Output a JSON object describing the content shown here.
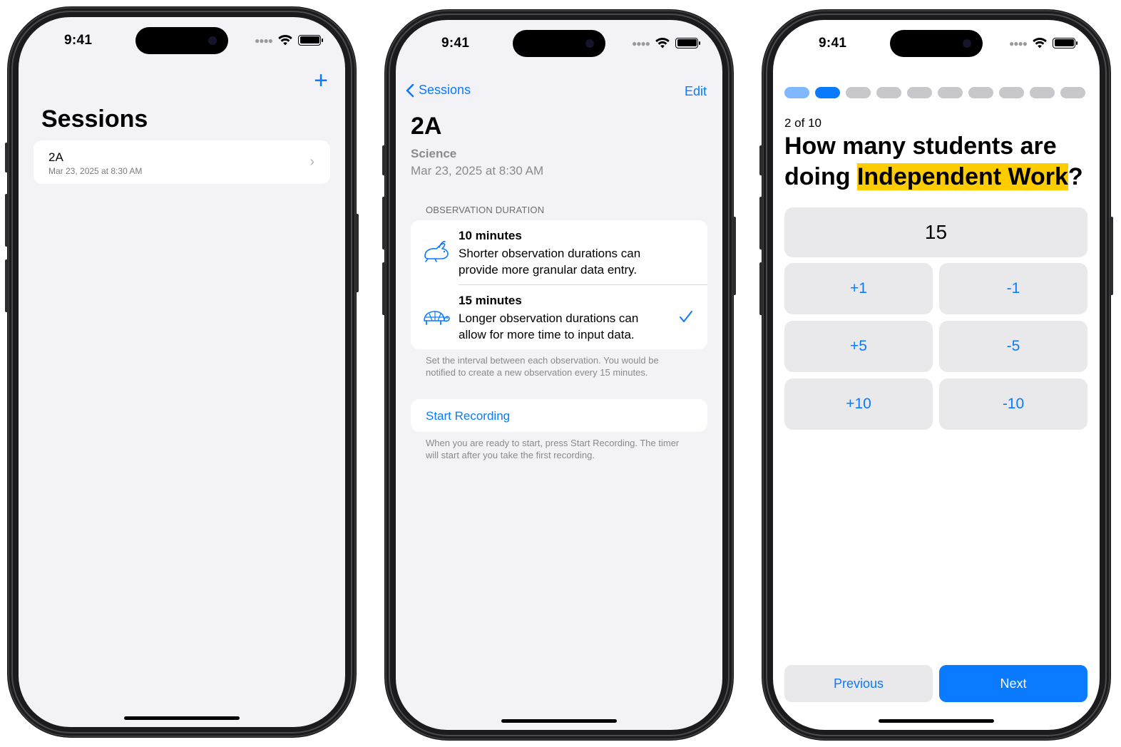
{
  "status": {
    "time": "9:41"
  },
  "screen1": {
    "add_icon": "plus-icon",
    "title": "Sessions",
    "sessions": [
      {
        "name": "2A",
        "date": "Mar 23, 2025 at 8:30 AM"
      }
    ]
  },
  "screen2": {
    "back_label": "Sessions",
    "edit_label": "Edit",
    "title": "2A",
    "subject": "Science",
    "date": "Mar 23, 2025 at 8:30 AM",
    "section_header": "OBSERVATION DURATION",
    "options": [
      {
        "title": "10 minutes",
        "description": "Shorter observation durations can provide more granular data entry.",
        "icon": "rabbit-icon",
        "selected": false
      },
      {
        "title": "15 minutes",
        "description": "Longer observation durations can allow for more time to input data.",
        "icon": "tortoise-icon",
        "selected": true
      }
    ],
    "section_footer": "Set the interval between each observation. You would be notified to create a new observation every 15 minutes.",
    "start_label": "Start Recording",
    "start_footer": "When you are ready to start, press Start Recording. The timer will start after you take the first recording."
  },
  "screen3": {
    "progress": {
      "current": 2,
      "total": 10
    },
    "question_count": "2 of 10",
    "question_prefix": "How many students are doing ",
    "question_highlight": "Independent Work",
    "question_suffix": "?",
    "value": "15",
    "steps": [
      "+1",
      "-1",
      "+5",
      "-5",
      "+10",
      "-10"
    ],
    "previous_label": "Previous",
    "next_label": "Next",
    "accent_color": "#0a7aff",
    "highlight_color": "#ffcc00"
  }
}
